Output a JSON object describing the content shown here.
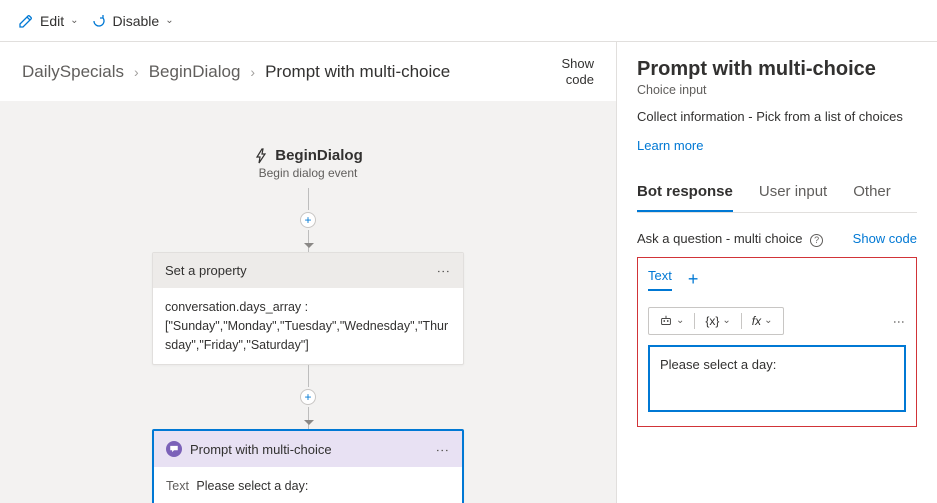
{
  "toolbar": {
    "edit": "Edit",
    "disable": "Disable"
  },
  "breadcrumb": {
    "root": "DailySpecials",
    "mid": "BeginDialog",
    "leaf": "Prompt with multi-choice"
  },
  "showCodeTop": "Show\ncode",
  "trigger": {
    "title": "BeginDialog",
    "subtitle": "Begin dialog event"
  },
  "nodes": {
    "setProp": {
      "title": "Set a property",
      "body": "conversation.days_array : [\"Sunday\",\"Monday\",\"Tuesday\",\"Wednesday\",\"Thursday\",\"Friday\",\"Saturday\"]"
    },
    "prompt": {
      "title": "Prompt with multi-choice",
      "label": "Text",
      "value": "Please select a day:"
    }
  },
  "props": {
    "title": "Prompt with multi-choice",
    "type": "Choice input",
    "desc": "Collect information - Pick from a list of choices",
    "learn": "Learn more",
    "tabs": {
      "bot": "Bot response",
      "user": "User input",
      "other": "Other"
    },
    "section": "Ask a question - multi choice",
    "showCode": "Show code",
    "subTab": "Text",
    "miniTool": {
      "var": "{x}",
      "fx": "fx"
    },
    "textValue": "Please select a day:"
  }
}
